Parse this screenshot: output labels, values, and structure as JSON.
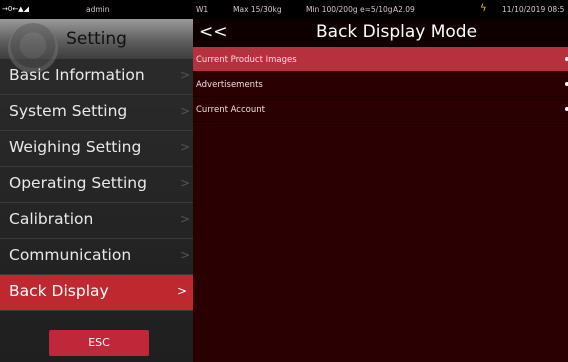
{
  "status_bar": {
    "left_icons": "→0←▲◢",
    "user": "admin",
    "scale_id": "W1",
    "max": "Max 15/30kg",
    "min": "Min 100/200g e=5/10g",
    "version": "A2.09",
    "datetime": "11/10/2019 08:5"
  },
  "sidebar": {
    "title": "Setting",
    "items": [
      {
        "label": "Basic Information",
        "chevron": ">"
      },
      {
        "label": "System Setting",
        "chevron": ">"
      },
      {
        "label": "Weighing Setting",
        "chevron": ">"
      },
      {
        "label": "Operating Setting",
        "chevron": ">"
      },
      {
        "label": "Calibration",
        "chevron": ">"
      },
      {
        "label": "Communication",
        "chevron": ">"
      },
      {
        "label": "Back Display",
        "chevron": ">",
        "selected": true
      }
    ],
    "esc_label": "ESC"
  },
  "main": {
    "back_label": "<<",
    "title": "Back Display Mode",
    "rows": [
      {
        "label": "Current Product Images",
        "selected": true
      },
      {
        "label": "Advertisements"
      },
      {
        "label": "Current Account"
      }
    ]
  },
  "colors": {
    "accent_red": "#c0282f",
    "selected_row": "#b6303e",
    "panel_bg": "#2a0003"
  }
}
